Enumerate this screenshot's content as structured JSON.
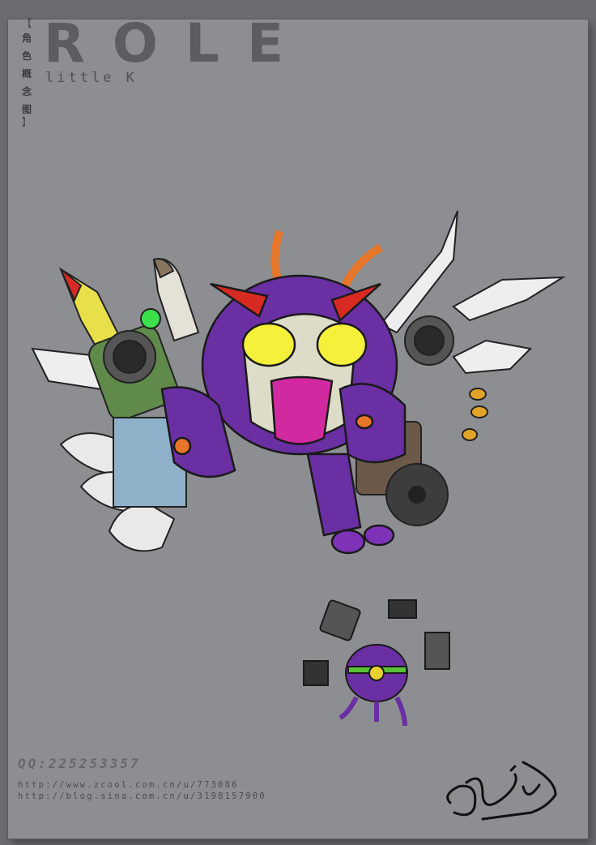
{
  "header": {
    "title": "ROLE",
    "subtitle": "little K",
    "vertical_label_chars": [
      "角",
      "色",
      "概",
      "念",
      "图"
    ],
    "bracket_open": "【",
    "bracket_close": "】"
  },
  "footer": {
    "qq": "QQ:225253357",
    "url_1": "http://www.zcool.com.cn/u/773086",
    "url_2": "http://blog.sina.com.cn/u/3198157900"
  },
  "illustrations": [
    {
      "name": "main-robot-character",
      "icon": "robot-icon"
    },
    {
      "name": "small-drone-character",
      "icon": "drone-icon"
    }
  ],
  "colors": {
    "card_bg": "#8c8e91",
    "outer_bg": "#6a6c70",
    "robot_purple": "#6a2fa3",
    "robot_orange": "#e8762a",
    "eye_yellow": "#f5f03a",
    "mouth_pink": "#d12aa0"
  }
}
